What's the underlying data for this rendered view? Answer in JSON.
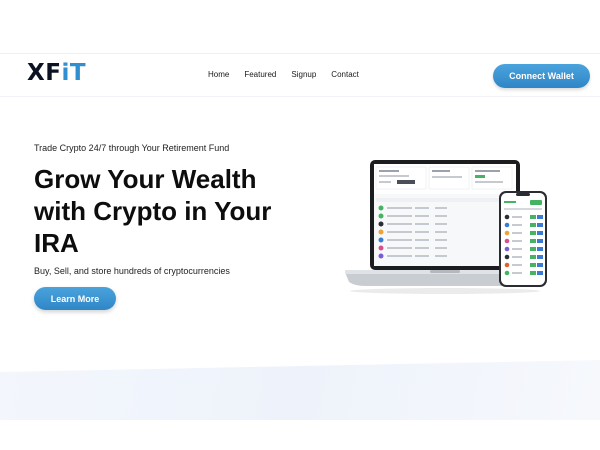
{
  "brand": {
    "logo_main": "XF",
    "logo_accent": "iT"
  },
  "nav": {
    "items": [
      "Home",
      "Featured",
      "Signup",
      "Contact"
    ]
  },
  "header": {
    "connect_label": "Connect Wallet"
  },
  "hero": {
    "tagline": "Trade Crypto 24/7 through Your Retirement Fund",
    "headline": "Grow Your Wealth\nwith Crypto in Your\nIRA",
    "description": "Buy, Sell, and store hundreds of cryptocurrencies",
    "cta_label": "Learn More"
  },
  "colors": {
    "accent": "#2f8fd0",
    "button": "#3a95d4",
    "band": "#f1f5fb"
  },
  "icons": [
    "laptop-mockup",
    "phone-mockup"
  ]
}
